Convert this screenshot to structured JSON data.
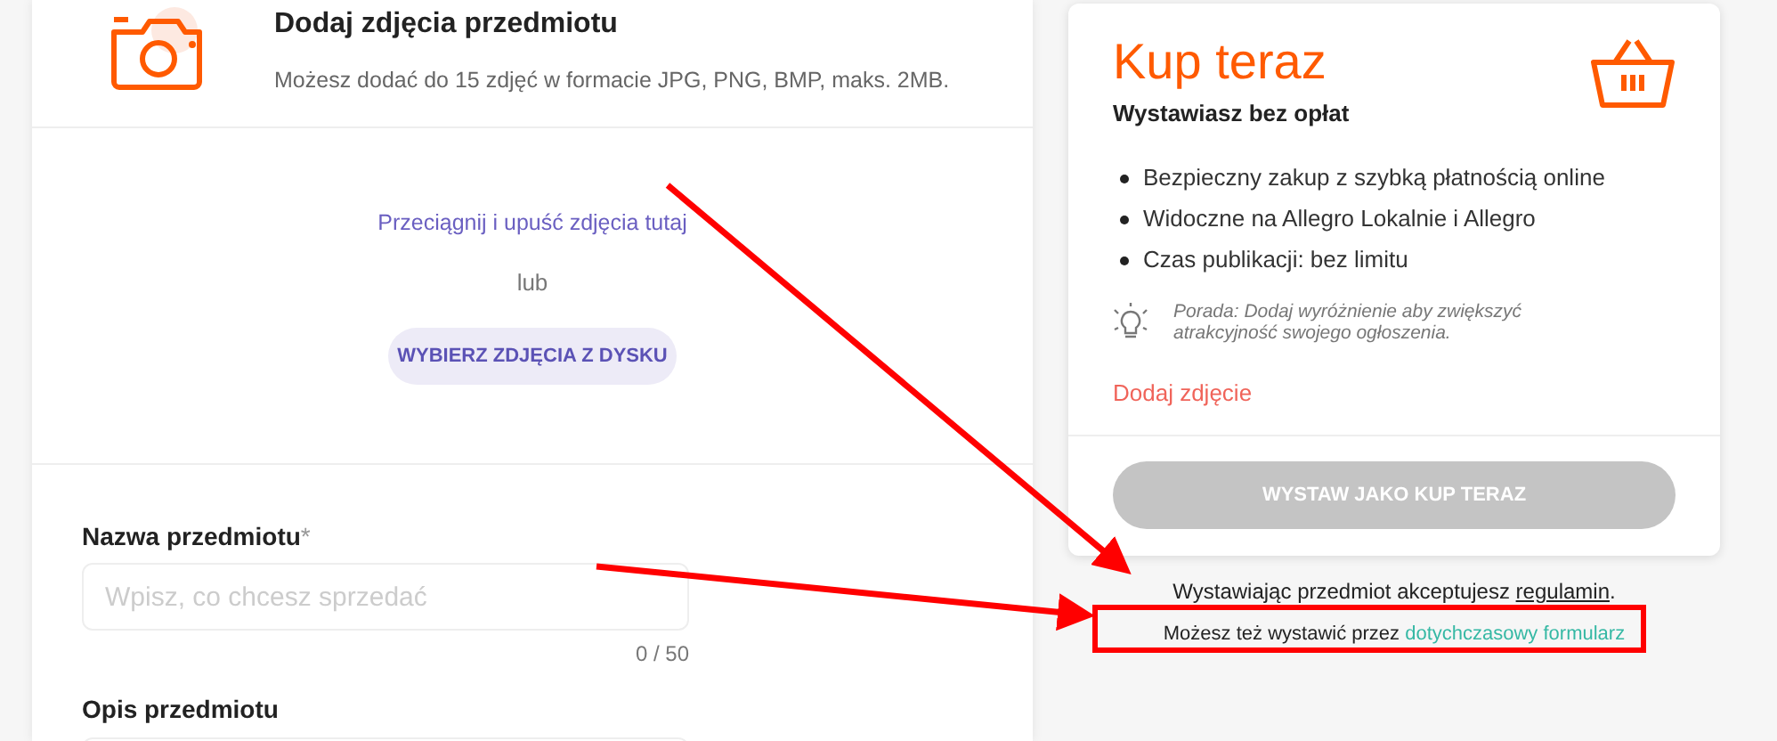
{
  "photos": {
    "title": "Dodaj zdjęcia przedmiotu",
    "subtitle": "Możesz dodać do 15 zdjęć w formacie JPG, PNG, BMP, maks. 2MB.",
    "drop_hint": "Przeciągnij i upuść zdjęcia tutaj",
    "or": "lub",
    "button": "WYBIERZ ZDJĘCIA Z DYSKU"
  },
  "fields": [
    {
      "kind": "input",
      "label": "Nazwa przedmiotu",
      "required": "*",
      "placeholder": "Wpisz, co chcesz sprzedać",
      "counter": "0 / 50"
    },
    {
      "kind": "textarea",
      "label": "Opis przedmiotu"
    }
  ],
  "offer": {
    "title": "Kup teraz",
    "subtitle": "Wystawiasz bez opłat",
    "bullets": [
      "Bezpieczny zakup z szybką płatnością online",
      "Widoczne na Allegro Lokalnie i Allegro",
      "Czas publikacji: bez limitu"
    ],
    "tip": "Porada: Dodaj wyróżnienie aby zwiększyć atrakcyjność swojego ogłoszenia.",
    "missing": "Dodaj zdjęcie",
    "button": {
      "label": "WYSTAW JAKO KUP TERAZ",
      "disabled": true
    }
  },
  "terms": {
    "text": "Wystawiając przedmiot akceptujesz ",
    "link": "regulamin",
    "suffix": "."
  },
  "legacy": {
    "text": "Możesz też wystawić przez ",
    "link": "dotychczasowy formularz"
  }
}
